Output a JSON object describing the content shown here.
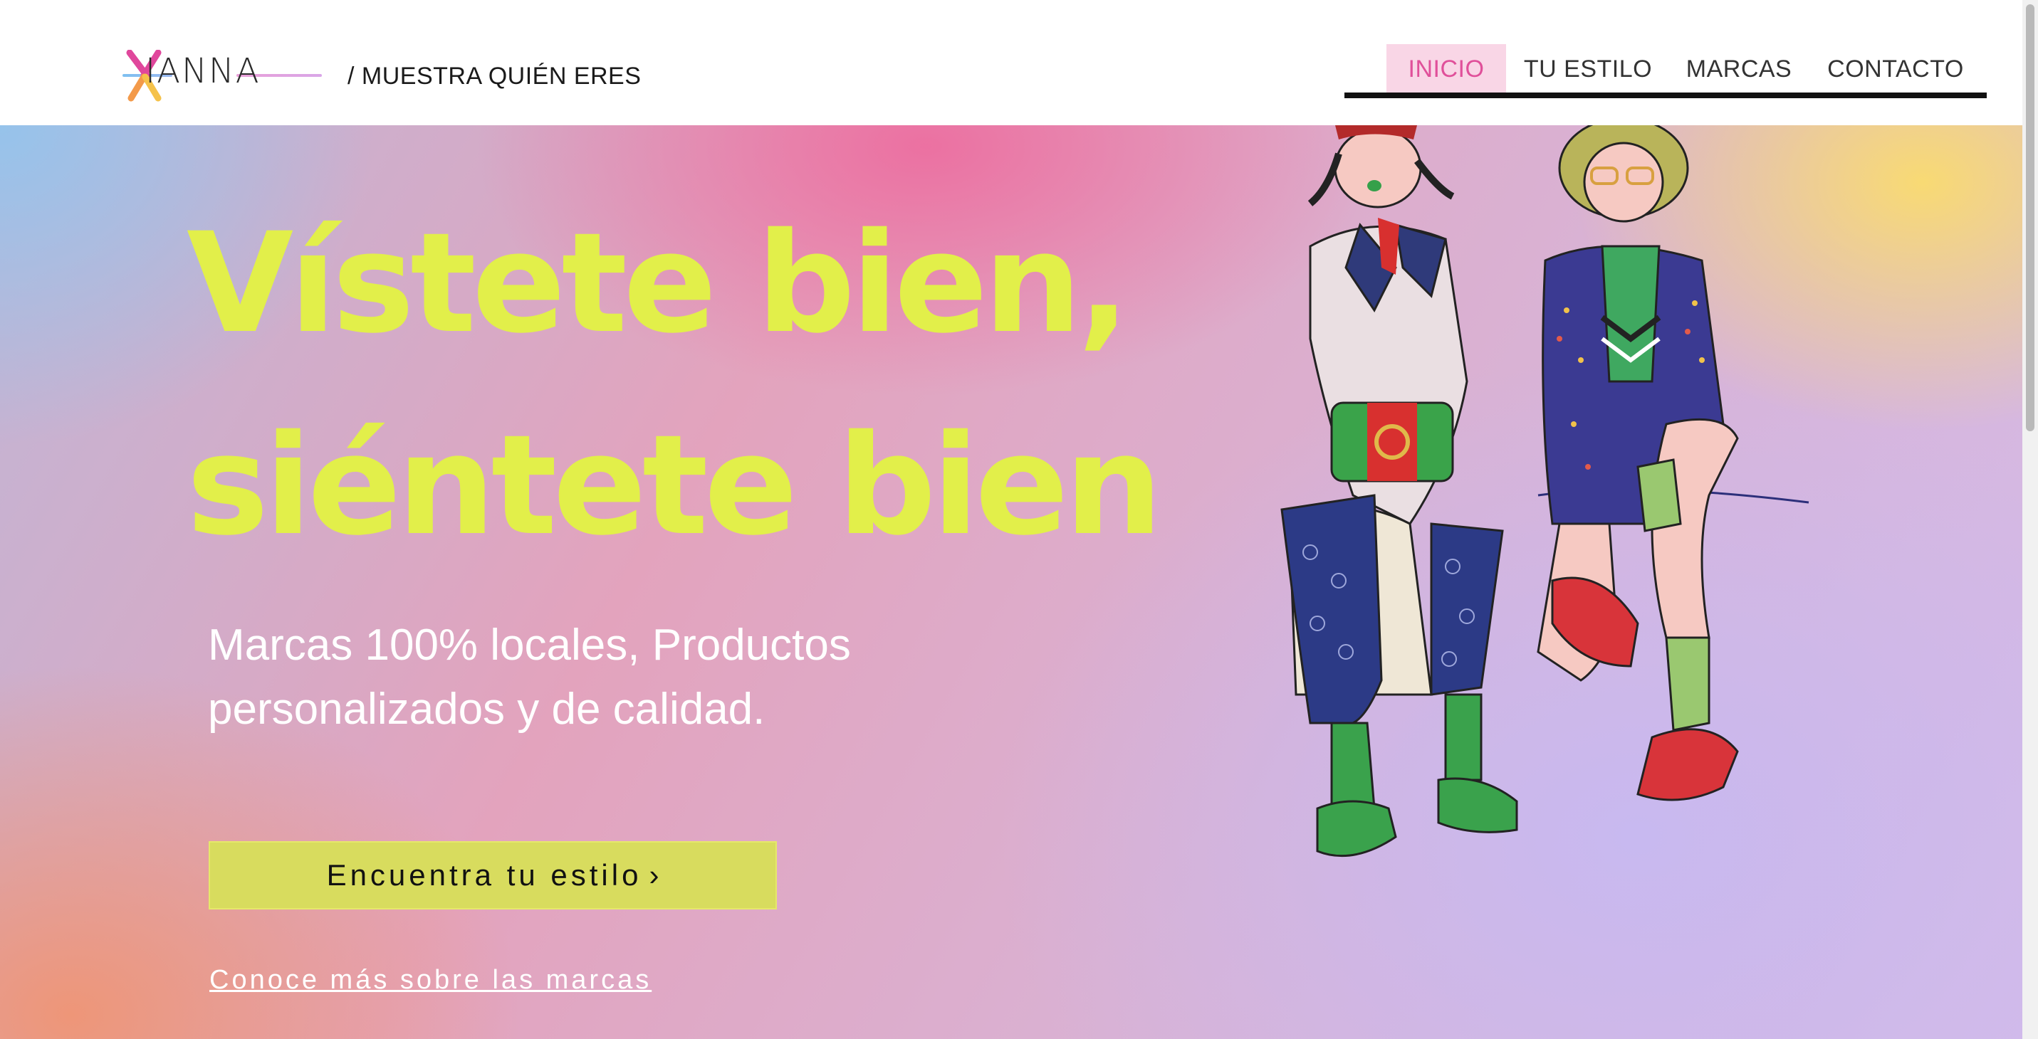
{
  "header": {
    "logo_text": "IANNA",
    "tagline": "/ MUESTRA QUIÉN ERES",
    "nav": [
      {
        "label": "INICIO",
        "active": true
      },
      {
        "label": "TU ESTILO",
        "active": false
      },
      {
        "label": "MARCAS",
        "active": false
      },
      {
        "label": "CONTACTO",
        "active": false
      }
    ]
  },
  "hero": {
    "headline_line1": "Vístete bien,",
    "headline_line2": "siéntete bien",
    "subtext_line1": "Marcas 100% locales, Productos",
    "subtext_line2": "personalizados y de calidad.",
    "cta_label": "Encuentra tu estilo",
    "cta_arrow": "›",
    "secondary_link": "Conoce más sobre las marcas",
    "illustration_icon": "two-fashion-girls-illustration"
  },
  "colors": {
    "accent_yellow": "#e2ef4a",
    "button_yellow": "#d8dc5e",
    "nav_active_bg": "#f9d6e6",
    "nav_active_text": "#e0509a"
  }
}
